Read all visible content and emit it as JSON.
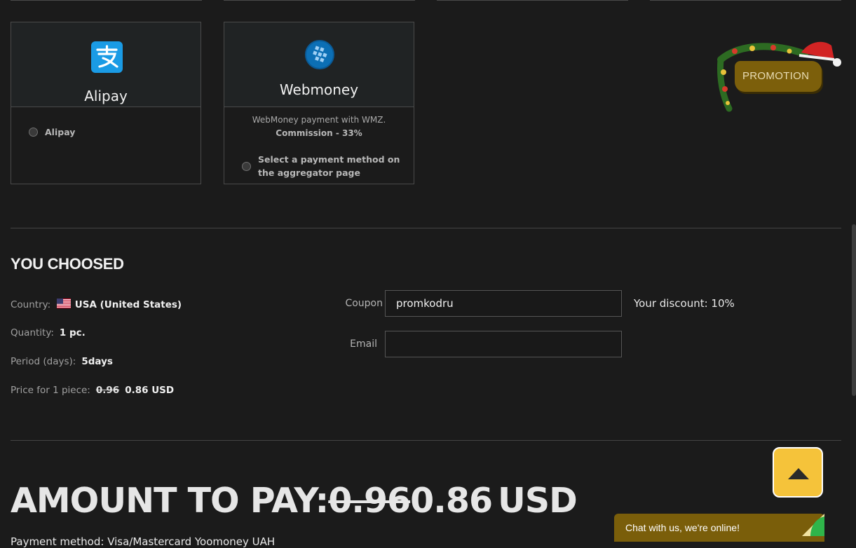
{
  "payment_methods": [
    {
      "title": "Alipay",
      "icon": "alipay-icon",
      "option_label": "Alipay"
    },
    {
      "title": "Webmoney",
      "icon": "webmoney-icon",
      "description": "WebMoney payment with WMZ.",
      "commission": "Commission - 33%",
      "option_label_line1": "Select a payment method on",
      "option_label_line2": "the aggregator page"
    }
  ],
  "promotion": {
    "label": "PROMOTION"
  },
  "summary": {
    "title": "YOU CHOOSED",
    "country_label": "Country:",
    "country_value": "USA (United States)",
    "quantity_label": "Quantity:",
    "quantity_value": "1 pc.",
    "period_label": "Period (days):",
    "period_value": "5days",
    "price_label": "Price for 1 piece:",
    "price_old": "0.96",
    "price_new": "0.86 USD"
  },
  "form": {
    "coupon_label": "Coupon",
    "coupon_value": "promkodru",
    "email_label": "Email",
    "email_value": "",
    "discount_text": "Your discount: 10%"
  },
  "amount": {
    "prefix": "AMOUNT TO PAY:",
    "old": "0.96",
    "new": "0.86",
    "currency": "USD"
  },
  "payment_line": {
    "label": "Payment method:",
    "value": "Visa/Mastercard Yoomoney UAH"
  },
  "chat": {
    "label": "Chat with us, we're online!"
  },
  "colors": {
    "background": "#1b1b1b",
    "accent_gold": "#f5c33a",
    "promo_brown": "#7c5f0b",
    "alipay_blue": "#1a9be5",
    "webmoney_blue": "#0c6fb5"
  }
}
